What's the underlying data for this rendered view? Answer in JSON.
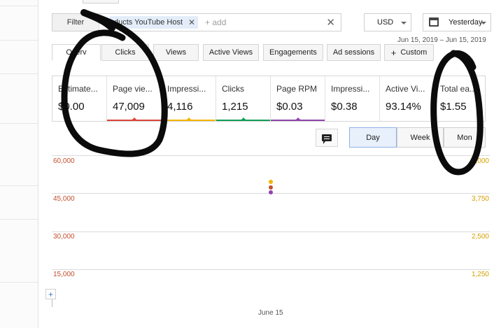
{
  "filter": {
    "label": "Filter",
    "chip_text": "ducts YouTube Host",
    "add_placeholder": "+ add"
  },
  "currency": {
    "selected": "USD"
  },
  "date": {
    "selected": "Yesterday",
    "range": "Jun 15, 2019 – Jun 15, 2019"
  },
  "tabs": [
    {
      "label": "Overv"
    },
    {
      "label": "Clicks"
    },
    {
      "label": "Views"
    },
    {
      "label": "Active Views"
    },
    {
      "label": "Engagements"
    },
    {
      "label": "Ad sessions"
    },
    {
      "label": "Custom"
    }
  ],
  "metrics": [
    {
      "name": "Estimate...",
      "value": "$0.00",
      "color": "#1a73e8"
    },
    {
      "name": "Page vie...",
      "value": "47,009",
      "color": "#db4437"
    },
    {
      "name": "Impressi...",
      "value": "4,116",
      "color": "#f4b400"
    },
    {
      "name": "Clicks",
      "value": "1,215",
      "color": "#0f9d58"
    },
    {
      "name": "Page RPM",
      "value": "$0.03",
      "color": "#8e44ad"
    },
    {
      "name": "Impressi...",
      "value": "$0.38",
      "color": ""
    },
    {
      "name": "Active Vi...",
      "value": "93.14%",
      "color": ""
    },
    {
      "name": "Total ea...",
      "value": "$1.55",
      "color": ""
    }
  ],
  "granularity": {
    "day": "Day",
    "week": "Week",
    "month": "Mon"
  },
  "chart_data": {
    "type": "scatter",
    "left_axis_ticks": [
      "60,000",
      "45,000",
      "30,000",
      "15,000"
    ],
    "right_axis_ticks": [
      "5,000",
      "3,750",
      "2,500",
      "1,250"
    ],
    "x_ticks": [
      "June 15"
    ],
    "series": [
      {
        "color": "#f4b400",
        "x": "June 15",
        "value": 4116
      },
      {
        "color": "#c0502e",
        "x": "June 15",
        "value": 47009
      },
      {
        "color": "#8e44ad",
        "x": "June 15",
        "value": 0.03
      }
    ]
  }
}
